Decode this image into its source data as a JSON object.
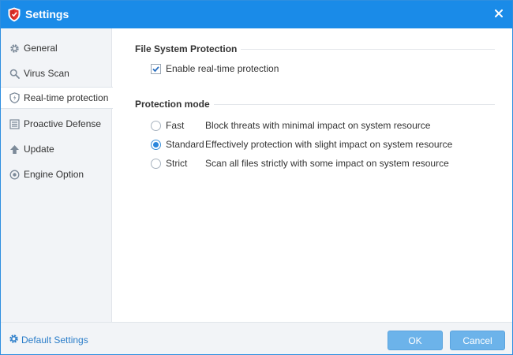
{
  "window": {
    "title": "Settings",
    "accent_color": "#1a8be8",
    "logo_icon": "shield-logo-icon",
    "close_icon": "close-icon"
  },
  "sidebar": {
    "items": [
      {
        "label": "General",
        "icon": "gear-icon",
        "active": false
      },
      {
        "label": "Virus Scan",
        "icon": "search-icon",
        "active": false
      },
      {
        "label": "Real-time protection",
        "icon": "shield-icon",
        "active": true
      },
      {
        "label": "Proactive Defense",
        "icon": "defense-icon",
        "active": false
      },
      {
        "label": "Update",
        "icon": "upload-icon",
        "active": false
      },
      {
        "label": "Engine Option",
        "icon": "engine-icon",
        "active": false
      }
    ]
  },
  "file_system": {
    "title": "File System Protection",
    "enable_label": "Enable real-time protection",
    "enabled": true
  },
  "protection_mode": {
    "title": "Protection mode",
    "selected": "Standard",
    "options": [
      {
        "label": "Fast",
        "description": "Block threats with minimal impact on system resource"
      },
      {
        "label": "Standard",
        "description": "Effectively protection with slight impact on system resource"
      },
      {
        "label": "Strict",
        "description": "Scan all files strictly with some impact on system resource"
      }
    ]
  },
  "footer": {
    "default_settings_label": "Default Settings",
    "ok_label": "OK",
    "cancel_label": "Cancel"
  }
}
